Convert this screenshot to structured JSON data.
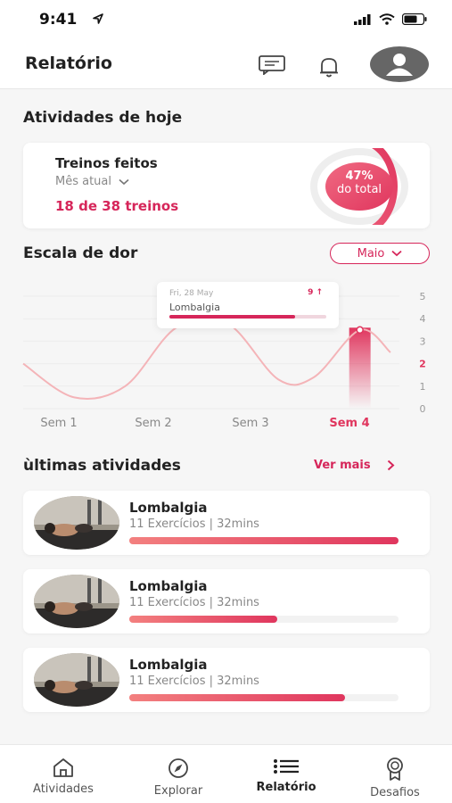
{
  "status": {
    "time": "9:41"
  },
  "header": {
    "title": "Relatório"
  },
  "today": {
    "section_title": "Atividades de hoje",
    "card_title": "Treinos feitos",
    "period_select": "Mês atual",
    "count_text": "18 de 38 treinos",
    "ring_percent_label": "47%",
    "ring_caption": "do total",
    "ring_fraction": 0.47,
    "done": 18,
    "total": 38
  },
  "pain": {
    "section_title": "Escala de dor",
    "period_pill": "Maio",
    "tooltip": {
      "date": "Fri, 28 May",
      "value": "9 ↑",
      "name": "Lombalgia",
      "progress": 0.8
    }
  },
  "chart_data": {
    "type": "line",
    "categories": [
      "Sem 1",
      "Sem 2",
      "Sem 3",
      "Sem 4"
    ],
    "active_category": "Sem 4",
    "highlight_y": "2",
    "yticks": [
      "5",
      "4",
      "3",
      "2",
      "1",
      "0"
    ],
    "ylim": [
      0,
      5
    ],
    "series": [
      {
        "x": [
          0,
          0.5,
          1.0,
          1.5,
          2.0,
          2.5,
          2.85,
          3.3,
          3.6
        ],
        "values": [
          2.0,
          0.5,
          1.0,
          3.6,
          3.8,
          1.3,
          1.4,
          3.5,
          2.5
        ]
      }
    ],
    "grid": true,
    "colors": {
      "line": "#f4b4b8",
      "highlight": "#e0365e"
    }
  },
  "activities": {
    "section_title": "ùltimas atividades",
    "more_label": "Ver mais",
    "items": [
      {
        "name": "Lombalgia",
        "meta": "11 Exercícios | 32mins",
        "progress": 1.0
      },
      {
        "name": "Lombalgia",
        "meta": "11 Exercícios | 32mins",
        "progress": 0.55
      },
      {
        "name": "Lombalgia",
        "meta": "11 Exercícios | 32mins",
        "progress": 0.8
      }
    ]
  },
  "tabs": [
    {
      "label": "Atividades",
      "icon": "home-icon"
    },
    {
      "label": "Explorar",
      "icon": "compass-icon"
    },
    {
      "label": "Relatório",
      "icon": "list-icon"
    },
    {
      "label": "Desafios",
      "icon": "medal-icon"
    }
  ],
  "colors": {
    "accent": "#d6265a",
    "ring_start": "#f06a82",
    "ring_end": "#e0365e"
  }
}
